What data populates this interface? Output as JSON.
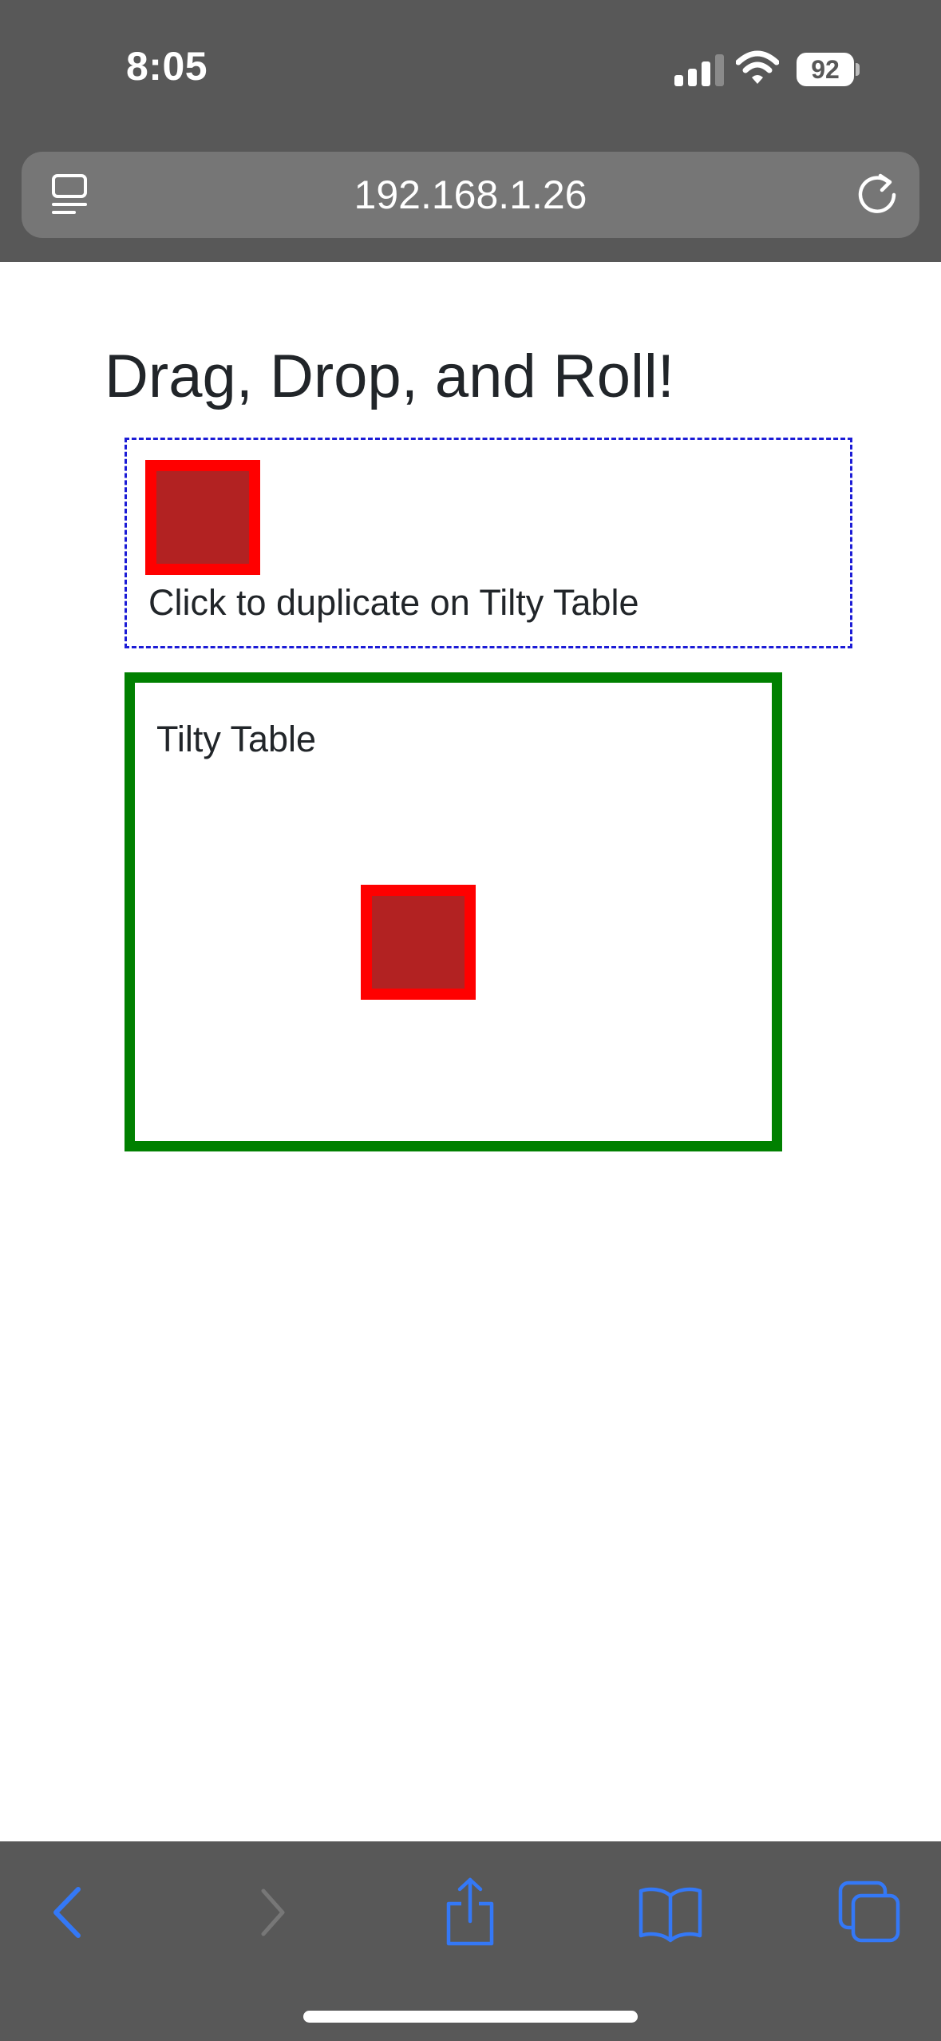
{
  "status_bar": {
    "time": "8:05",
    "battery_level": "92",
    "signal_icon": "cellular-signal-icon",
    "wifi_icon": "wifi-icon"
  },
  "browser": {
    "url": "192.168.1.26",
    "reader_icon": "reader-mode-icon",
    "reload_icon": "reload-icon"
  },
  "page": {
    "title": "Drag, Drop, and Roll!",
    "palette_instruction": "Click to duplicate on Tilty Table",
    "tilty_table_label": "Tilty Table"
  },
  "toolbar": {
    "icons": [
      "back-icon",
      "forward-icon",
      "share-icon",
      "bookmarks-icon",
      "tabs-icon"
    ]
  },
  "colors": {
    "chrome_bg": "#585858",
    "url_bar_bg": "#767676",
    "accent_blue": "#3478f6",
    "box_fill": "#b22222",
    "box_border": "#ff0000",
    "table_border": "#008000",
    "palette_border": "#1c1cd6"
  }
}
